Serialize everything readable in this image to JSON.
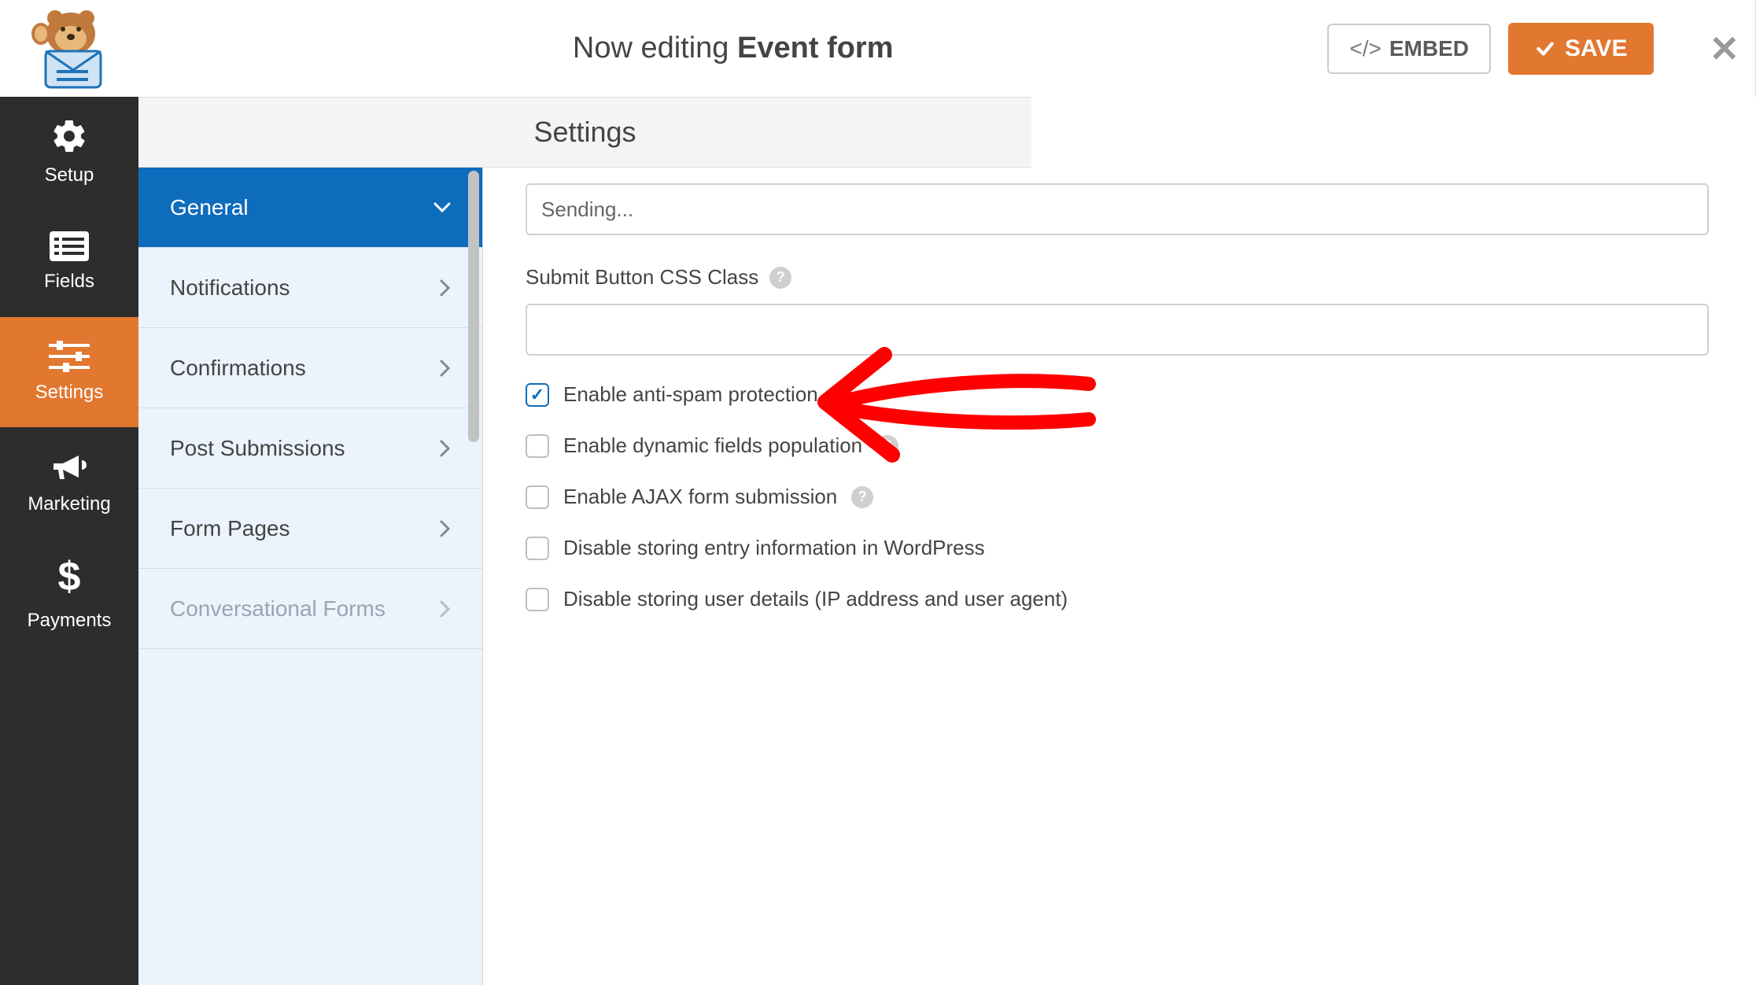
{
  "header": {
    "prefix": "Now editing ",
    "form_name": "Event form",
    "embed_label": "EMBED",
    "save_label": "SAVE"
  },
  "left_nav": [
    {
      "id": "setup",
      "label": "Setup"
    },
    {
      "id": "fields",
      "label": "Fields"
    },
    {
      "id": "settings",
      "label": "Settings"
    },
    {
      "id": "marketing",
      "label": "Marketing"
    },
    {
      "id": "payments",
      "label": "Payments"
    }
  ],
  "left_nav_active": "settings",
  "panel_title": "Settings",
  "sub_nav": [
    {
      "id": "general",
      "label": "General",
      "kind": "expanded",
      "active": true
    },
    {
      "id": "notifications",
      "label": "Notifications",
      "kind": "nav"
    },
    {
      "id": "confirmations",
      "label": "Confirmations",
      "kind": "nav"
    },
    {
      "id": "post-submissions",
      "label": "Post Submissions",
      "kind": "nav"
    },
    {
      "id": "form-pages",
      "label": "Form Pages",
      "kind": "nav"
    },
    {
      "id": "conversational-forms",
      "label": "Conversational Forms",
      "kind": "nav",
      "disabled": true
    }
  ],
  "main": {
    "sending_value": "Sending...",
    "css_class_label": "Submit Button CSS Class",
    "css_class_value": "",
    "checkboxes": [
      {
        "id": "anti-spam",
        "label": "Enable anti-spam protection",
        "checked": true,
        "help": false
      },
      {
        "id": "dynamic-fields",
        "label": "Enable dynamic fields population",
        "checked": false,
        "help": true
      },
      {
        "id": "ajax-submission",
        "label": "Enable AJAX form submission",
        "checked": false,
        "help": true
      },
      {
        "id": "disable-entry",
        "label": "Disable storing entry information in WordPress",
        "checked": false,
        "help": false
      },
      {
        "id": "disable-user",
        "label": "Disable storing user details (IP address and user agent)",
        "checked": false,
        "help": false
      }
    ]
  }
}
